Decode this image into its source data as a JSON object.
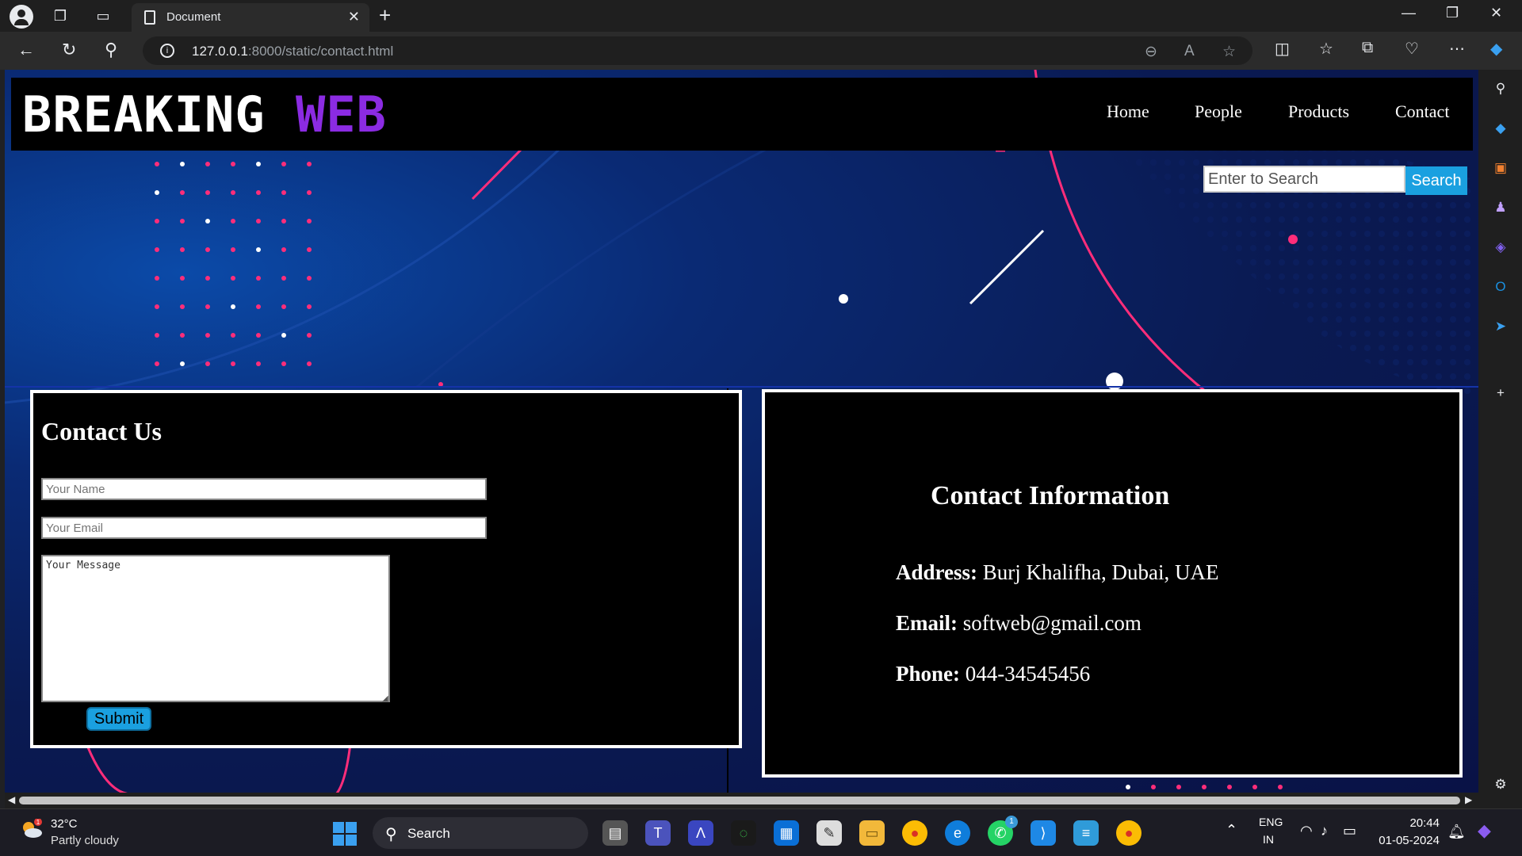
{
  "browser": {
    "tab_title": "Document",
    "url_host": "127.0.0.1",
    "url_rest": ":8000/static/contact.html"
  },
  "site": {
    "logo_word1": "BREAKING",
    "logo_word2": "WEB",
    "nav": [
      "Home",
      "People",
      "Products",
      "Contact"
    ],
    "search_placeholder": "Enter to Search",
    "search_button": "Search"
  },
  "contact_form": {
    "heading": "Contact Us",
    "name_placeholder": "Your Name",
    "email_placeholder": "Your Email",
    "message_placeholder": "Your Message",
    "submit_label": "Submit"
  },
  "contact_info": {
    "heading": "Contact Information",
    "address_label": "Address:",
    "address_value": "Burj Khalifha, Dubai, UAE",
    "email_label": "Email:",
    "email_value": "softweb@gmail.com",
    "phone_label": "Phone:",
    "phone_value": "044-34545456"
  },
  "taskbar": {
    "weather_temp": "32°C",
    "weather_desc": "Partly cloudy",
    "weather_badge": "1",
    "search_label": "Search",
    "lang_1": "ENG",
    "lang_2": "IN",
    "time": "20:44",
    "date": "01-05-2024",
    "whatsapp_badge": "1"
  },
  "colors": {
    "accent_purple": "#8b2be2",
    "button_blue": "#1aa0e0",
    "hero_pink": "#ff2d7a"
  }
}
